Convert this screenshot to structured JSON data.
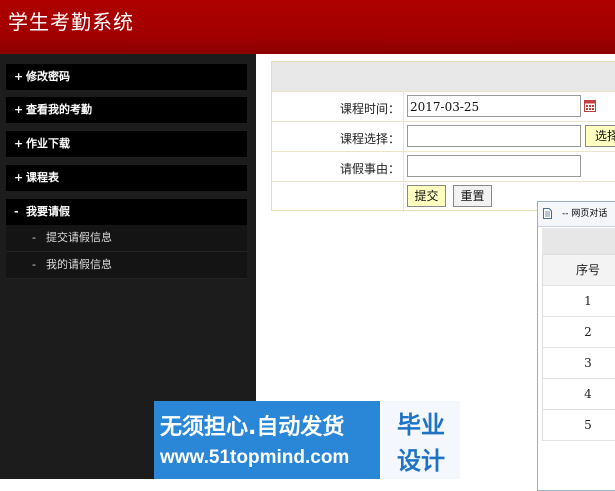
{
  "header": {
    "title": "学生考勤系统"
  },
  "sidebar": {
    "items": [
      {
        "sign": "+",
        "label": "修改密码"
      },
      {
        "sign": "+",
        "label": "查看我的考勤"
      },
      {
        "sign": "+",
        "label": "作业下载"
      },
      {
        "sign": "+",
        "label": "课程表"
      },
      {
        "sign": "-",
        "label": "我要请假"
      }
    ],
    "subitems": [
      {
        "sign": "-",
        "label": "提交请假信息"
      },
      {
        "sign": "-",
        "label": "我的请假信息"
      }
    ]
  },
  "form": {
    "time_label": "课程时间：",
    "time_value": "2017-03-25",
    "course_label": "课程选择：",
    "course_value": "",
    "select_button": "选择",
    "reason_label": "请假事由：",
    "reason_value": "",
    "submit_button": "提交",
    "reset_button": "重置"
  },
  "dialog": {
    "title": "-- 网页对话",
    "column_header": "序号",
    "rows": [
      "1",
      "2",
      "3",
      "4",
      "5"
    ]
  },
  "watermark": {
    "line1": "无须担心.自动发货",
    "line2": "www.51topmind.com",
    "badge1": "毕业",
    "badge2": "设计"
  },
  "colors": {
    "header": "#a00000",
    "sidebar": "#1c1c1c",
    "watermark": "#2a86d6"
  }
}
